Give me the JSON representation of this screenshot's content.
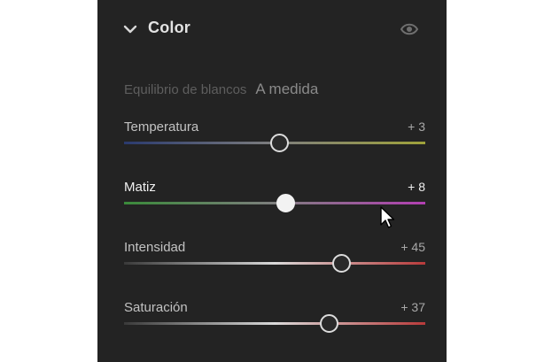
{
  "panel": {
    "title": "Color",
    "icons": {
      "collapse": "chevron-down-icon",
      "visibility": "eye-icon"
    },
    "white_balance": {
      "label": "Equilibrio de blancos",
      "value": "A medida"
    }
  },
  "sliders": [
    {
      "label": "Temperatura",
      "value": "+ 3",
      "position": 0.515,
      "gradient": [
        "#2a3a6e",
        "#7e7e7e",
        "#9fa23a"
      ],
      "active": false
    },
    {
      "label": "Matiz",
      "value": "+ 8",
      "position": 0.535,
      "gradient": [
        "#3a8a3a",
        "#7e7e7e",
        "#b23fb2"
      ],
      "active": true
    },
    {
      "label": "Intensidad",
      "value": "+ 45",
      "position": 0.72,
      "gradient": [
        "#3a3a3a",
        "#dadada",
        "#b83a3a"
      ],
      "active": false
    },
    {
      "label": "Saturación",
      "value": "+ 37",
      "position": 0.68,
      "gradient": [
        "#3a3a3a",
        "#dadada",
        "#b83a3a"
      ],
      "active": false
    }
  ],
  "colors": {
    "panel_bg": "#232323",
    "page_bg": "#ffffff"
  }
}
